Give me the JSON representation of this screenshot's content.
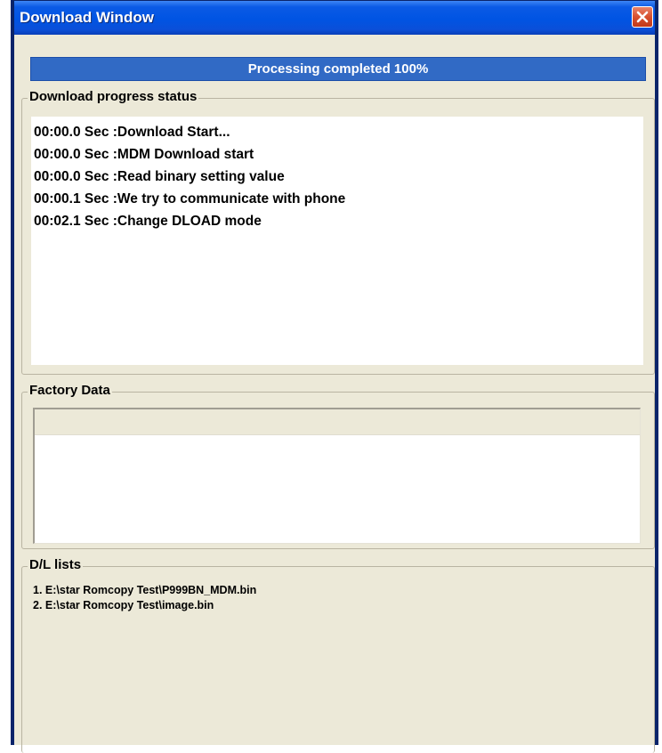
{
  "window": {
    "title": "Download Window"
  },
  "progress": {
    "text": "Processing completed 100%",
    "percent": 100
  },
  "status": {
    "legend": "Download progress status",
    "lines": [
      "00:00.0 Sec  :Download Start...",
      "00:00.0 Sec  :MDM Download start",
      "00:00.0 Sec  :Read binary setting value",
      "00:00.1 Sec  :We try to communicate with phone",
      "00:02.1 Sec  :Change DLOAD mode"
    ]
  },
  "factory": {
    "legend": "Factory Data"
  },
  "dl_lists": {
    "legend": "D/L lists",
    "items": [
      "1. E:\\star Romcopy Test\\P999BN_MDM.bin",
      "2. E:\\star Romcopy Test\\image.bin"
    ]
  },
  "colors": {
    "titlebar": "#0054e3",
    "progress_fill": "#316ac5",
    "window_bg": "#ece9d8",
    "close_button": "#d7502f"
  },
  "icons": {
    "close": "close-icon"
  }
}
